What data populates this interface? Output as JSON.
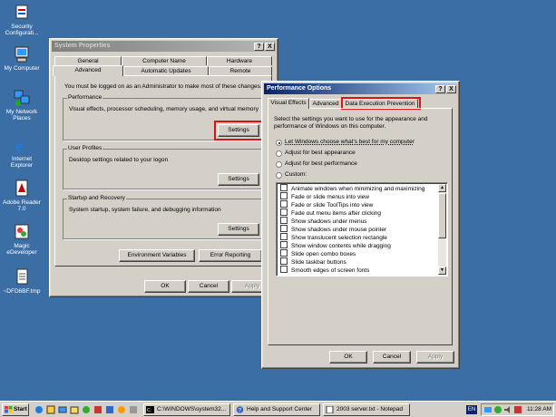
{
  "desktop": {
    "icons": [
      {
        "label1": "Security",
        "label2": "Configurati...",
        "icon": "security-config-icon"
      },
      {
        "label1": "My Computer",
        "label2": "",
        "icon": "my-computer-icon"
      },
      {
        "label1": "My Network",
        "label2": "Places",
        "icon": "network-places-icon"
      },
      {
        "label1": "Internet",
        "label2": "Explorer",
        "icon": "internet-explorer-icon"
      },
      {
        "label1": "Adobe Reader",
        "label2": "7.0",
        "icon": "adobe-reader-icon"
      },
      {
        "label1": "Magic",
        "label2": "eDeveloper",
        "icon": "magic-edeveloper-icon"
      },
      {
        "label1": "~DFD6BF.tmp",
        "label2": "",
        "icon": "tmp-file-icon"
      }
    ]
  },
  "system_properties": {
    "title": "System Properties",
    "help_btn": "?",
    "close_btn": "X",
    "tabs_row1": [
      "General",
      "Computer Name",
      "Hardware"
    ],
    "tabs_row2": [
      "Advanced",
      "Automatic Updates",
      "Remote"
    ],
    "notice": "You must be logged on as an Administrator to make most of these changes.",
    "performance": {
      "label": "Performance",
      "desc": "Visual effects, processor scheduling, memory usage, and virtual memory",
      "button": "Settings"
    },
    "user_profiles": {
      "label": "User Profiles",
      "desc": "Desktop settings related to your logon",
      "button": "Settings"
    },
    "startup": {
      "label": "Startup and Recovery",
      "desc": "System startup, system failure, and debugging information",
      "button": "Settings"
    },
    "env_button": "Environment Variables",
    "error_button": "Error Reporting",
    "ok": "OK",
    "cancel": "Cancel",
    "apply": "Apply"
  },
  "performance_options": {
    "title": "Performance Options",
    "help_btn": "?",
    "close_btn": "X",
    "tabs": [
      "Visual Effects",
      "Advanced",
      "Data Execution Prevention"
    ],
    "intro1": "Select the settings you want to use for the appearance and",
    "intro2": "performance of Windows on this computer.",
    "radios": [
      {
        "label": "Let Windows choose what's best for my computer",
        "selected": true
      },
      {
        "label": "Adjust for best appearance",
        "selected": false
      },
      {
        "label": "Adjust for best performance",
        "selected": false
      },
      {
        "label": "Custom:",
        "selected": false
      }
    ],
    "effects": [
      "Animate windows when minimizing and maximizing",
      "Fade or slide menus into view",
      "Fade or slide ToolTips into view",
      "Fade out menu items after clicking",
      "Show shadows under menus",
      "Show shadows under mouse pointer",
      "Show translucent selection rectangle",
      "Show window contents while dragging",
      "Slide open combo boxes",
      "Slide taskbar buttons",
      "Smooth edges of screen fonts"
    ],
    "ok": "OK",
    "cancel": "Cancel",
    "apply": "Apply"
  },
  "taskbar": {
    "start": "Start",
    "tasks": [
      "C:\\WINDOWS\\system32...",
      "Help and Support Center",
      "2003 server.txt - Notepad"
    ],
    "lang": "EN",
    "clock": "11:28 AM"
  },
  "colors": {
    "desktop": "#3a6ea5",
    "highlight": "#e01010",
    "title_active": "#0a246a"
  }
}
